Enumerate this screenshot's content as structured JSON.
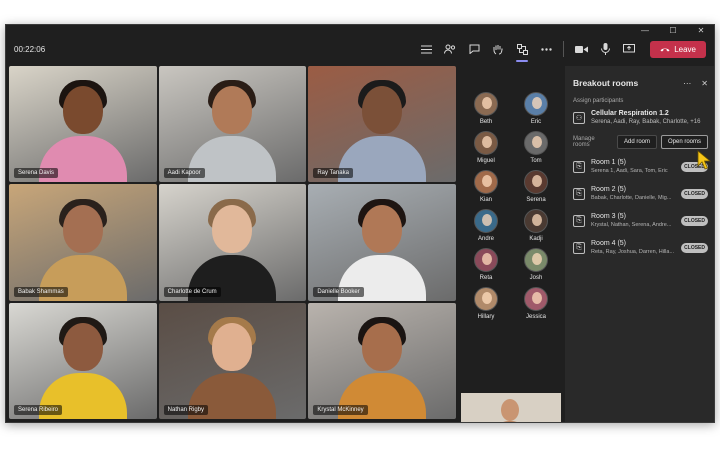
{
  "meeting": {
    "timer": "00:22:06",
    "leave_label": "Leave"
  },
  "window_controls": [
    "—",
    "☐",
    "✕"
  ],
  "toolbar_icons": [
    "list-icon",
    "people-icon",
    "chat-icon",
    "raise-hand-icon",
    "breakout-rooms-icon",
    "more-icon",
    "camera-icon",
    "microphone-icon",
    "share-icon"
  ],
  "tiles": [
    {
      "name": "Serena Davis",
      "bg": "#d9d4c8",
      "skin": "#7a4a2e",
      "hair": "#1c1410",
      "shirt": "#e08bb0"
    },
    {
      "name": "Aadi Kapoor",
      "bg": "#c9c6c0",
      "skin": "#b07a58",
      "hair": "#2a1d16",
      "shirt": "#bfc3c6"
    },
    {
      "name": "Ray Tanaka",
      "bg": "#9b5c44",
      "skin": "#7b5038",
      "hair": "#1b1b1b",
      "shirt": "#9aa7bd"
    },
    {
      "name": "Babak Shammas",
      "bg": "#c8a679",
      "skin": "#a46f52",
      "hair": "#2a211c",
      "shirt": "#c79d5a"
    },
    {
      "name": "Charlotte de Crum",
      "bg": "#d6d3cc",
      "skin": "#e1b89a",
      "hair": "#8a6a4a",
      "shirt": "#1e1e1e"
    },
    {
      "name": "Danielle Booker",
      "bg": "#a8aeb3",
      "skin": "#b07856",
      "hair": "#1e1512",
      "shirt": "#ececec"
    },
    {
      "name": "Serena Ribeiro",
      "bg": "#d9d8d3",
      "skin": "#8d5a3f",
      "hair": "#1f1915",
      "shirt": "#e8c02a"
    },
    {
      "name": "Nathan Rigby",
      "bg": "#5a4d45",
      "skin": "#e0b090",
      "hair": "#a57a4a",
      "shirt": "#8a5a3a"
    },
    {
      "name": "Krystal McKinney",
      "bg": "#b9b3ad",
      "skin": "#a76e4c",
      "hair": "#1a1412",
      "shirt": "#d08a35"
    }
  ],
  "roster": [
    {
      "name": "Beth",
      "color": "#8a6a52"
    },
    {
      "name": "Eric",
      "color": "#5a7fa8"
    },
    {
      "name": "Miguel",
      "color": "#7a5a44"
    },
    {
      "name": "Tom",
      "color": "#6a6a6a"
    },
    {
      "name": "Kian",
      "color": "#a06a4a"
    },
    {
      "name": "Serena",
      "color": "#5a3a30"
    },
    {
      "name": "Andre",
      "color": "#3a6a8a"
    },
    {
      "name": "Kadji",
      "color": "#4a3a32"
    },
    {
      "name": "Reta",
      "color": "#8a4a5a"
    },
    {
      "name": "Josh",
      "color": "#7a8a6a"
    },
    {
      "name": "Hillary",
      "color": "#b08a6a"
    },
    {
      "name": "Jessica",
      "color": "#a05a6a"
    }
  ],
  "panel": {
    "title": "Breakout rooms",
    "assign_label": "Assign participants",
    "session_title": "Cellular Respiration 1.2",
    "session_members": "Serena, Aadi, Ray, Babak, Charlotte, +16",
    "manage_label": "Manage rooms",
    "add_room": "Add room",
    "open_rooms": "Open rooms",
    "rooms": [
      {
        "name": "Room 1 (5)",
        "members": "Serena 1, Aadi, Sara, Tom, Eric",
        "status": "CLOSED"
      },
      {
        "name": "Room 2 (5)",
        "members": "Babak, Charlotte, Danielle, Mig...",
        "status": "CLOSED"
      },
      {
        "name": "Room 3 (5)",
        "members": "Krystal, Nathan, Serena, Andre...",
        "status": "CLOSED"
      },
      {
        "name": "Room 4 (5)",
        "members": "Reta, Ray, Joshua, Darren, Hilla...",
        "status": "CLOSED"
      }
    ]
  },
  "colors": {
    "leave": "#c4314b",
    "accent": "#8b8cf0",
    "cursor": "#f5c518"
  }
}
